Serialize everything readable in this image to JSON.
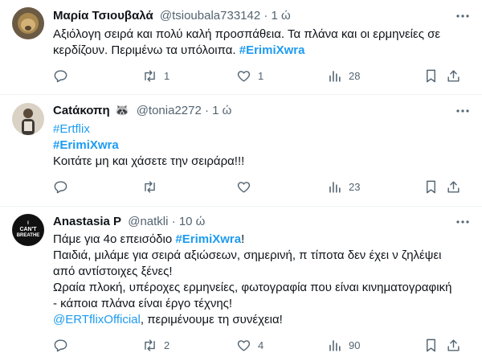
{
  "tweets": [
    {
      "author_name": "Μαρία Τσιουβαλά",
      "handle": "@tsioubala733142",
      "time": "1 ώ",
      "text_line1": "Αξιόλογη σειρά και πολύ καλή προσπάθεια. Τα πλάνα και οι ερμηνείες σε",
      "text_line2": "κερδίζουν. Περιμένω τα υπόλοιπα.",
      "hashtag": "#ErimiXwra",
      "replies": "",
      "retweets": "1",
      "likes": "1",
      "views": "28"
    },
    {
      "author_name": "Catάκοπη",
      "emoji": "🦝",
      "handle": "@tonia2272",
      "time": "1 ώ",
      "hashtag1": "#Ertflix",
      "hashtag2": "#ErimiXwra",
      "text": "Κοιτάτε μη και χάσετε την σειράρα!!!",
      "replies": "",
      "retweets": "",
      "likes": "",
      "views": "23"
    },
    {
      "author_name": "Anastasia P",
      "handle": "@natkli",
      "time": "10 ώ",
      "avatar_text_1": "I",
      "avatar_text_2": "CAN'T",
      "avatar_text_3": "BREATHE",
      "line1_text": "Πάμε για 4ο επεισόδιο",
      "line1_hashtag": "#ErimiXwra",
      "line1_end": "!",
      "line2": "Παιδιά, μιλάμε για σειρά αξιώσεων, σημερινή, π τίποτα δεν έχει ν ζηλέψει",
      "line3": "από αντίστοιχες ξένες!",
      "line4": "Ωραία πλοκή, υπέροχες ερμηνείες, φωτογραφία που είναι κινηματογραφική",
      "line5": "- κάποια πλάνα είναι έργο τέχνης!",
      "mention": "@ERTflixOfficial",
      "line6_end": ", περιμένουμε τη συνέχεια!",
      "replies": "",
      "retweets": "2",
      "likes": "4",
      "views": "90"
    }
  ],
  "colors": {
    "text": "#0f1419",
    "secondary": "#536471",
    "link": "#1d9bf0",
    "divider": "#eff3f4"
  },
  "icons": [
    "more-icon",
    "reply-icon",
    "retweet-icon",
    "like-icon",
    "views-icon",
    "bookmark-icon",
    "share-icon"
  ]
}
